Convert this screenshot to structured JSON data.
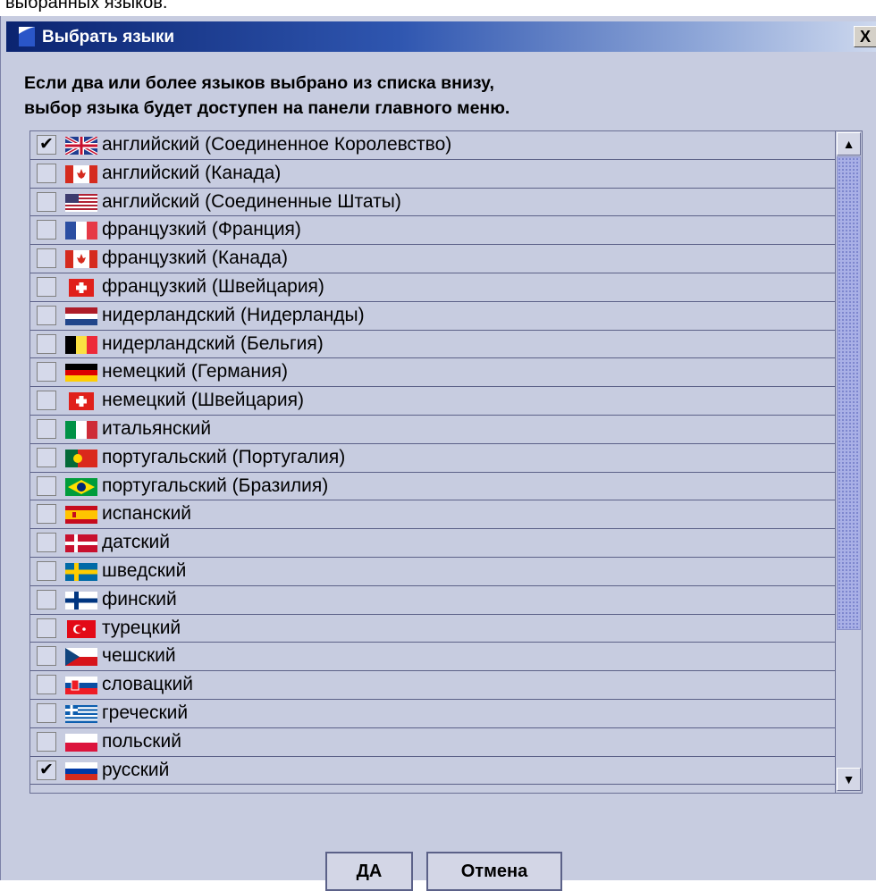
{
  "top_caption": "выбранных языков.",
  "dialog": {
    "title": "Выбрать языки",
    "close_label": "X",
    "message_line1": "Если два или более языков выбрано из списка внизу,",
    "message_line2": "выбор языка будет доступен на панели главного меню."
  },
  "languages": [
    {
      "label": "английский (Соединенное Королевство)",
      "checked": true,
      "flag": "uk-flag-icon"
    },
    {
      "label": "английский (Канада)",
      "checked": false,
      "flag": "canada-flag-icon"
    },
    {
      "label": "английский (Соединенные Штаты)",
      "checked": false,
      "flag": "usa-flag-icon"
    },
    {
      "label": "французкий (Франция)",
      "checked": false,
      "flag": "france-flag-icon"
    },
    {
      "label": "французкий (Канада)",
      "checked": false,
      "flag": "canada-flag-icon"
    },
    {
      "label": "французкий (Швейцария)",
      "checked": false,
      "flag": "switzerland-flag-icon"
    },
    {
      "label": "нидерландский (Нидерланды)",
      "checked": false,
      "flag": "netherlands-flag-icon"
    },
    {
      "label": "нидерландский (Бельгия)",
      "checked": false,
      "flag": "belgium-flag-icon"
    },
    {
      "label": "немецкий (Германия)",
      "checked": false,
      "flag": "germany-flag-icon"
    },
    {
      "label": "немецкий (Швейцария)",
      "checked": false,
      "flag": "switzerland-flag-icon"
    },
    {
      "label": "итальянский",
      "checked": false,
      "flag": "italy-flag-icon"
    },
    {
      "label": "португальский (Португалия)",
      "checked": false,
      "flag": "portugal-flag-icon"
    },
    {
      "label": "португальский (Бразилия)",
      "checked": false,
      "flag": "brazil-flag-icon"
    },
    {
      "label": "испанский",
      "checked": false,
      "flag": "spain-flag-icon"
    },
    {
      "label": "датский",
      "checked": false,
      "flag": "denmark-flag-icon"
    },
    {
      "label": "шведский",
      "checked": false,
      "flag": "sweden-flag-icon"
    },
    {
      "label": "финский",
      "checked": false,
      "flag": "finland-flag-icon"
    },
    {
      "label": "турецкий",
      "checked": false,
      "flag": "turkey-flag-icon"
    },
    {
      "label": "чешский",
      "checked": false,
      "flag": "czech-flag-icon"
    },
    {
      "label": "словацкий",
      "checked": false,
      "flag": "slovakia-flag-icon"
    },
    {
      "label": "греческий",
      "checked": false,
      "flag": "greece-flag-icon"
    },
    {
      "label": "польский",
      "checked": false,
      "flag": "poland-flag-icon"
    },
    {
      "label": "русский",
      "checked": true,
      "flag": "russia-flag-icon"
    }
  ],
  "check_mark": "✔",
  "scroll": {
    "up_arrow": "▲",
    "down_arrow": "▼"
  },
  "buttons": {
    "ok_label": "ДА",
    "cancel_label": "Отмена"
  },
  "colors": {
    "title_start": "#0b2470",
    "dialog_bg": "#c7cce0",
    "thumb": "#a9b0e6"
  }
}
